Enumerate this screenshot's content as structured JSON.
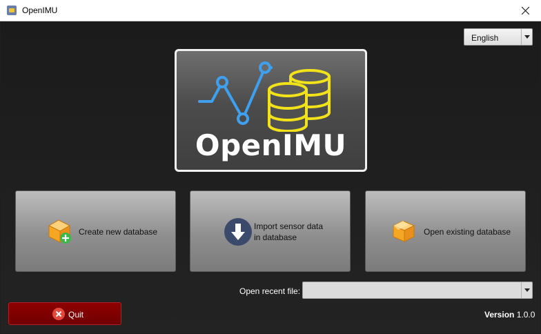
{
  "window": {
    "title": "OpenIMU"
  },
  "language": {
    "selected": "English"
  },
  "logo": {
    "text": "OpenIMU"
  },
  "actions": {
    "create": {
      "label": "Create new database"
    },
    "import": {
      "label_line1": "Import sensor data",
      "label_line2": "in database"
    },
    "open": {
      "label": "Open existing database"
    }
  },
  "recent": {
    "label": "Open recent file:",
    "value": ""
  },
  "quit": {
    "label": "Quit"
  },
  "version": {
    "label": "Version",
    "value": "1.0.0"
  },
  "icons": {
    "app": "openimu-app-icon",
    "close": "close-icon",
    "dropdown": "chevron-down-icon",
    "create": "database-add-icon",
    "import": "download-arrow-icon",
    "open": "database-open-icon",
    "quit": "close-circle-icon"
  },
  "colors": {
    "logo_line": "#3fa0f0",
    "logo_database": "#f2e21a",
    "quit_bg": "#800000",
    "add_badge": "#3cb84a",
    "import_icon": "#3b4a6b"
  }
}
